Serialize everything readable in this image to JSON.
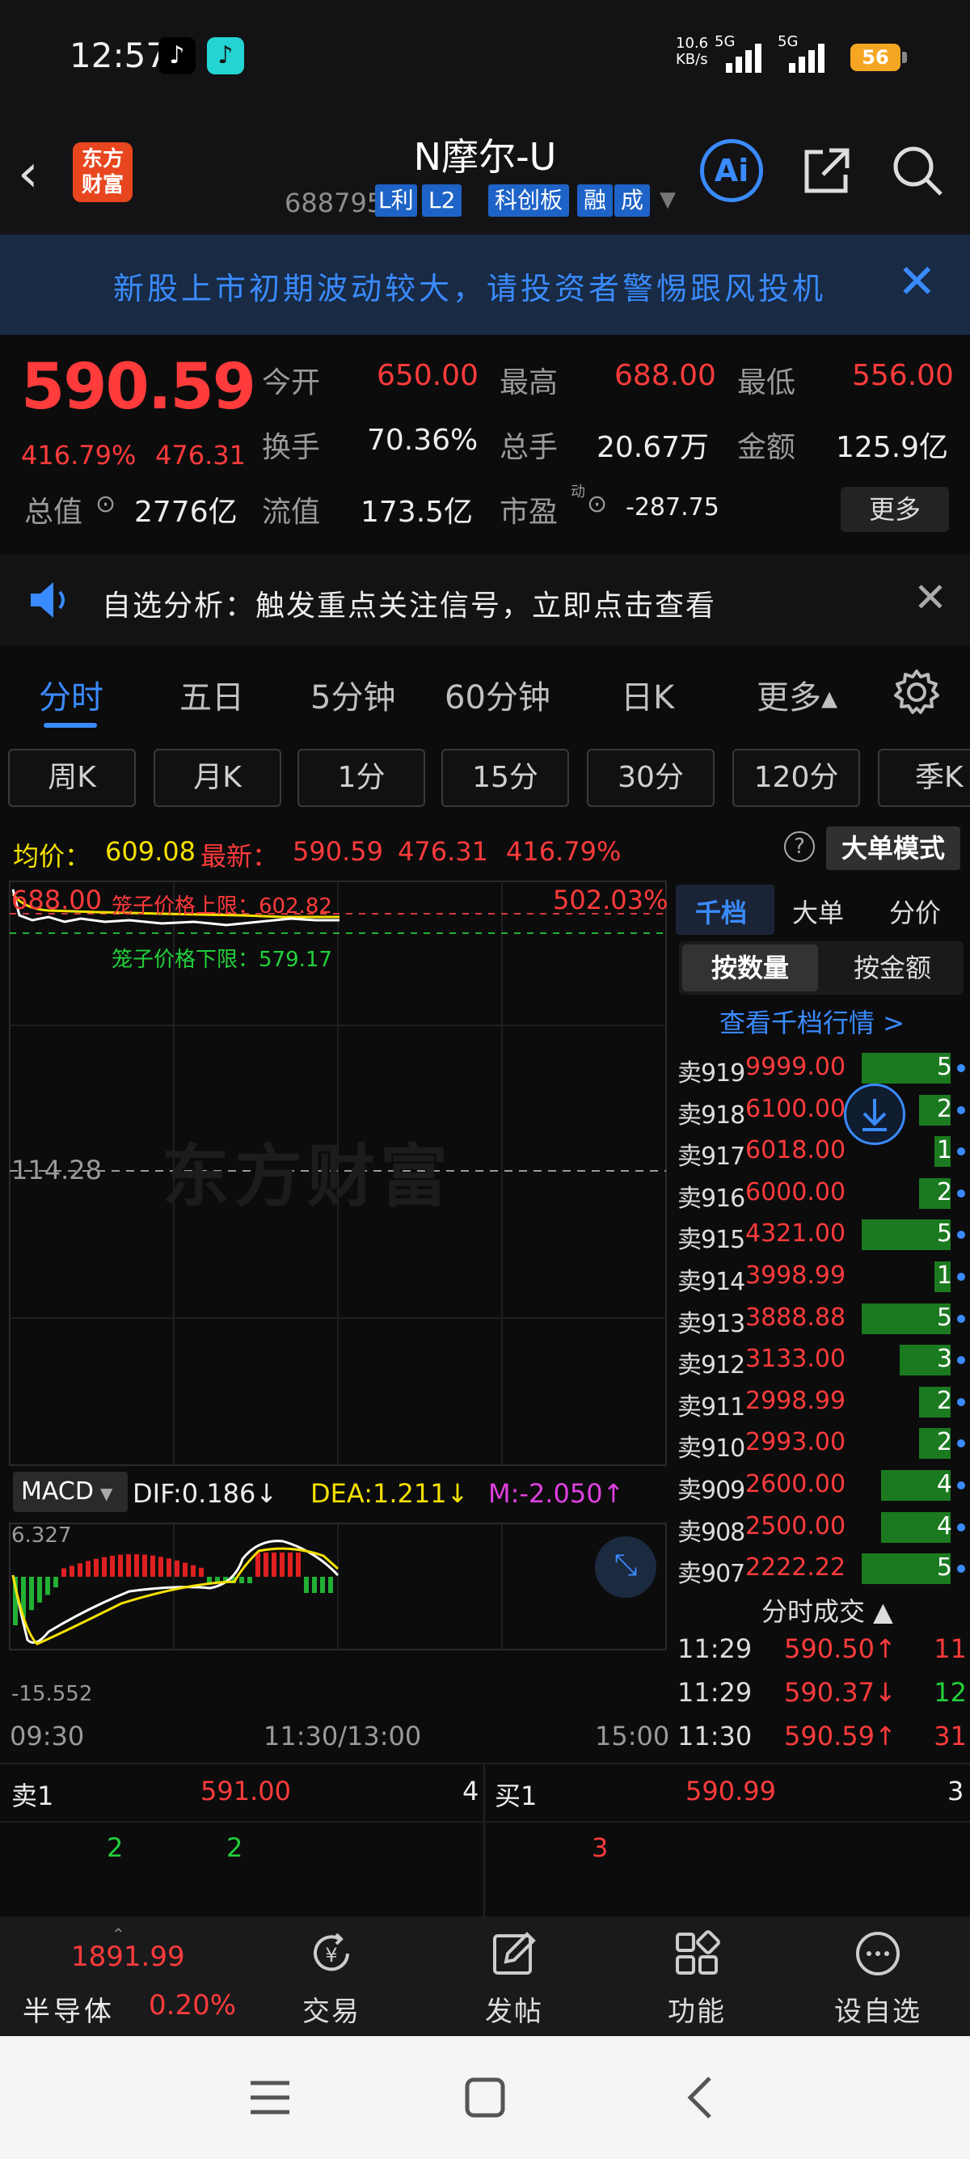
{
  "status_bar": {
    "time": "12:57",
    "net_speed_top": "10.6",
    "net_speed_unit": "KB/s",
    "sig1": "5G",
    "sig2": "5G",
    "battery": "56",
    "icons": [
      "tiktok-icon",
      "tiktok-lite-icon"
    ]
  },
  "header": {
    "logo_line1": "东方",
    "logo_line2": "财富",
    "name": "N摩尔-U",
    "code": "688795",
    "tags": [
      "L利",
      "L2",
      "科创板",
      "融",
      "成"
    ],
    "ai_label": "Ai"
  },
  "banner": {
    "text": "新股上市初期波动较大，请投资者警惕跟风投机"
  },
  "quote": {
    "price": "590.59",
    "change_pct": "416.79%",
    "change_amt": "476.31",
    "open_label": "今开",
    "open": "650.00",
    "high_label": "最高",
    "high": "688.00",
    "low_label": "最低",
    "low": "556.00",
    "turnover_label": "换手",
    "turnover": "70.36%",
    "volume_label": "总手",
    "volume": "20.67万",
    "amount_label": "金额",
    "amount": "125.9亿",
    "mcap_label": "总值",
    "mcap": "2776亿",
    "float_label": "流值",
    "float": "173.5亿",
    "pe_label": "市盈",
    "pe_sup": "动",
    "pe": "-287.75",
    "more": "更多"
  },
  "notice": {
    "text": "自选分析：触发重点关注信号，立即点击查看"
  },
  "tabs": [
    {
      "label": "分时",
      "active": true
    },
    {
      "label": "五日"
    },
    {
      "label": "5分钟"
    },
    {
      "label": "60分钟"
    },
    {
      "label": "日K"
    },
    {
      "label": "更多▴"
    }
  ],
  "kline_buttons": [
    "周K",
    "月K",
    "1分",
    "15分",
    "30分",
    "120分",
    "季K"
  ],
  "info_line": {
    "avg_label": "均价：",
    "avg": "609.08",
    "latest_label": "最新：",
    "latest": "590.59",
    "chg": "476.31",
    "pct": "416.79%",
    "big_mode": "大单模式"
  },
  "chart": {
    "top_price": "688.00",
    "top_pct": "502.03%",
    "upper_limit": "笼子价格上限：602.82",
    "lower_limit": "笼子价格下限：579.17",
    "mid_price": "114.28",
    "watermark": "东方财富",
    "macd_label": "MACD",
    "dif": "DIF:0.186↓",
    "dea": "DEA:1.211↓",
    "m": "M:-2.050↑",
    "macd_max": "6.327",
    "macd_min": "-15.552",
    "time_start": "09:30",
    "time_mid": "11:30/13:00",
    "time_end": "15:00"
  },
  "right_panel": {
    "tabs": [
      "千档",
      "大单",
      "分价"
    ],
    "seg_on": "按数量",
    "seg_off": "按金额",
    "view_link": "查看千档行情 >",
    "orders": [
      {
        "label": "卖919",
        "price": "9999.00",
        "vol": "5"
      },
      {
        "label": "卖918",
        "price": "6100.00",
        "vol": "2"
      },
      {
        "label": "卖917",
        "price": "6018.00",
        "vol": "1"
      },
      {
        "label": "卖916",
        "price": "6000.00",
        "vol": "2"
      },
      {
        "label": "卖915",
        "price": "4321.00",
        "vol": "5"
      },
      {
        "label": "卖914",
        "price": "3998.99",
        "vol": "1"
      },
      {
        "label": "卖913",
        "price": "3888.88",
        "vol": "5"
      },
      {
        "label": "卖912",
        "price": "3133.00",
        "vol": "3"
      },
      {
        "label": "卖911",
        "price": "2998.99",
        "vol": "2"
      },
      {
        "label": "卖910",
        "price": "2993.00",
        "vol": "2"
      },
      {
        "label": "卖909",
        "price": "2600.00",
        "vol": "4"
      },
      {
        "label": "卖908",
        "price": "2500.00",
        "vol": "4"
      },
      {
        "label": "卖907",
        "price": "2222.22",
        "vol": "5"
      }
    ],
    "trades_title": "分时成交 ▲",
    "trades": [
      {
        "time": "11:29",
        "price": "590.50↑",
        "vol": "11",
        "dir": "up"
      },
      {
        "time": "11:29",
        "price": "590.37↓",
        "vol": "12",
        "dir": "down"
      },
      {
        "time": "11:30",
        "price": "590.59↑",
        "vol": "31",
        "dir": "up"
      }
    ]
  },
  "level1": {
    "sell_label": "卖1",
    "sell_price": "591.00",
    "sell_vol": "4",
    "buy_label": "买1",
    "buy_price": "590.99",
    "buy_vol": "3",
    "sell_sub1": "2",
    "sell_sub2": "2",
    "buy_sub1": "3"
  },
  "bottom_nav": {
    "index_value": "1891.99",
    "index_name": "半导体",
    "index_pct": "0.20%",
    "items": [
      "交易",
      "发帖",
      "功能",
      "设自选"
    ]
  },
  "colors": {
    "up": "#ff3b3b",
    "down": "#22d03a",
    "accent": "#3a8bff",
    "bg": "#0c0c0d"
  }
}
